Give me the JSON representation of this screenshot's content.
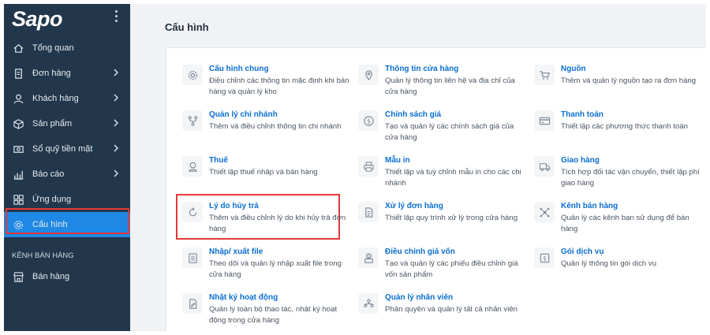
{
  "brand": {
    "logo_text": "Sapo"
  },
  "sidebar": {
    "items": [
      {
        "label": "Tổng quan",
        "icon": "home-icon",
        "has_chevron": false
      },
      {
        "label": "Đơn hàng",
        "icon": "invoice-icon",
        "has_chevron": true
      },
      {
        "label": "Khách hàng",
        "icon": "user-icon",
        "has_chevron": true
      },
      {
        "label": "Sản phẩm",
        "icon": "box-icon",
        "has_chevron": true
      },
      {
        "label": "Sổ quỹ tiền mặt",
        "icon": "cash-icon",
        "has_chevron": true
      },
      {
        "label": "Báo cáo",
        "icon": "report-icon",
        "has_chevron": true
      },
      {
        "label": "Ứng dụng",
        "icon": "apps-icon",
        "has_chevron": false
      },
      {
        "label": "Cấu hình",
        "icon": "gear-icon",
        "has_chevron": false,
        "active": true
      }
    ],
    "section_label": "KÊNH BÁN HÀNG",
    "channel_item": {
      "label": "Bán hàng",
      "icon": "store-icon"
    }
  },
  "main": {
    "title": "Cấu hình",
    "settings": [
      {
        "title": "Cấu hình chung",
        "desc": "Điều chỉnh các thông tin mặc định khi bán hàng và quản lý kho",
        "icon": "gear-icon"
      },
      {
        "title": "Thông tin cửa hàng",
        "desc": "Quản lý thông tin liên hệ và địa chỉ của cửa hàng",
        "icon": "location-pin-icon"
      },
      {
        "title": "Nguồn",
        "desc": "Thêm và quản lý nguồn tạo ra đơn hàng",
        "icon": "cart-icon"
      },
      {
        "title": "Quản lý chi nhánh",
        "desc": "Thêm và điều chỉnh thông tin chi nhánh",
        "icon": "branch-icon"
      },
      {
        "title": "Chính sách giá",
        "desc": "Tạo và quản lý các chính sách giá của cửa hàng",
        "icon": "dollar-icon"
      },
      {
        "title": "Thanh toán",
        "desc": "Thiết lập các phương thức thanh toán",
        "icon": "credit-card-icon"
      },
      {
        "title": "Thuế",
        "desc": "Thiết lập thuế nhập và bán hàng",
        "icon": "tax-icon"
      },
      {
        "title": "Mẫu in",
        "desc": "Thiết lập và tuỳ chỉnh mẫu in cho các chi nhánh",
        "icon": "printer-icon"
      },
      {
        "title": "Giao hàng",
        "desc": "Tích hợp đối tác vận chuyển, thiết lập phí giao hàng",
        "icon": "truck-icon"
      },
      {
        "title": "Lý do hủy trả",
        "desc": "Thêm và điều chỉnh lý do khi hủy trả đơn hàng",
        "icon": "refresh-icon",
        "highlighted": true
      },
      {
        "title": "Xử lý đơn hàng",
        "desc": "Thiết lập quy trình xử lý trong cửa hàng",
        "icon": "document-icon"
      },
      {
        "title": "Kênh bán hàng",
        "desc": "Quản lý các kênh bạn sử dụng để bán hàng",
        "icon": "network-icon"
      },
      {
        "title": "Nhập/ xuất file",
        "desc": "Theo dõi và quản lý nhập xuất file trong cửa hàng",
        "icon": "file-icon"
      },
      {
        "title": "Điều chỉnh giá vốn",
        "desc": "Tạo và quản lý các phiếu điều chỉnh giá vốn sản phẩm",
        "icon": "cost-adjust-icon"
      },
      {
        "title": "Gói dịch vụ",
        "desc": "Quản lý thông tin gói dịch vụ",
        "icon": "service-package-icon"
      },
      {
        "title": "Nhật ký hoạt động",
        "desc": "Quản lý toàn bộ thao tác, nhật ký hoạt động trong cửa hàng",
        "icon": "activity-log-icon"
      },
      {
        "title": "Quản lý nhân viên",
        "desc": "Phân quyền và quản lý tất cả nhân viên",
        "icon": "staff-icon"
      }
    ]
  },
  "colors": {
    "sidebar_bg": "#22374b",
    "accent": "#1f88e5",
    "link": "#0b6ed1",
    "highlight": "#e53935"
  }
}
